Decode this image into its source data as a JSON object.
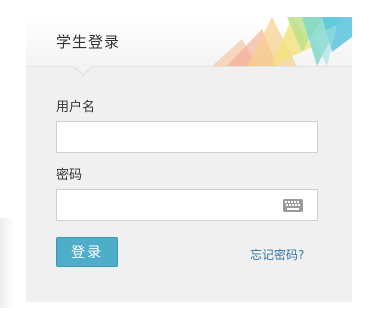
{
  "login_panel": {
    "title": "学生登录",
    "username_label": "用户名",
    "username_value": "",
    "password_label": "密码",
    "password_value": "",
    "submit_label": "登录",
    "forgot_label": "忘记密码?"
  },
  "colors": {
    "panel_bg": "#f0f0f0",
    "button_bg": "#4eaec9",
    "link": "#2f76a8"
  },
  "icons": {
    "keyboard": "keyboard-icon",
    "header_decoration": "geometric-triangles-decoration"
  }
}
